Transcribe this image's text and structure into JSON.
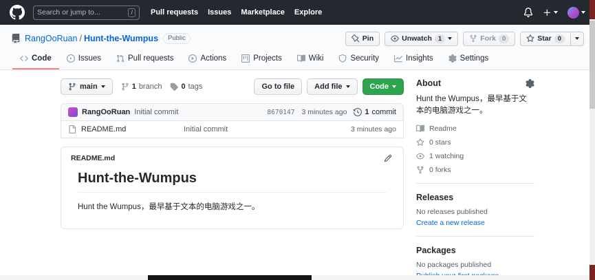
{
  "colors": {
    "header_bg": "#24292f",
    "link_blue": "#0366d6",
    "code_button_green": "#2ea44f",
    "active_tab_underline": "#f9826c",
    "commit_bar_bg": "#f6f8fa",
    "border": "#e1e4e8",
    "muted_text": "#586069",
    "scrollbar_red": "#7d2321"
  },
  "icons": {
    "github-logo": "github-octocat-mark",
    "bell": "notification-bell",
    "plus": "plus",
    "caret": "triangle-down",
    "repo": "repo-book",
    "pin": "pin",
    "eye": "eye",
    "fork": "git-fork",
    "star": "star-outline",
    "code": "angle-brackets",
    "issue": "circle-dot",
    "pull-request": "git-pull-request",
    "actions": "play-circle",
    "projects": "project-board",
    "wiki": "book",
    "security": "shield",
    "insights": "line-graph",
    "settings": "gear",
    "branch": "git-branch",
    "tag": "tag",
    "history": "clock-history",
    "file": "file-outline",
    "pencil": "pencil"
  },
  "header": {
    "search": {
      "placeholder": "Search or jump to...",
      "shortcut": "/"
    },
    "nav": [
      {
        "label": "Pull requests"
      },
      {
        "label": "Issues"
      },
      {
        "label": "Marketplace"
      },
      {
        "label": "Explore"
      }
    ]
  },
  "repo": {
    "owner": "RangOoRuan",
    "separator": "/",
    "name": "Hunt-the-Wumpus",
    "visibility": "Public",
    "actions": {
      "pin_label": "Pin",
      "unwatch_label": "Unwatch",
      "unwatch_count": "1",
      "fork_label": "Fork",
      "fork_count": "0",
      "star_label": "Star",
      "star_count": "0"
    }
  },
  "tabs": [
    {
      "label": "Code",
      "active": true
    },
    {
      "label": "Issues",
      "active": false
    },
    {
      "label": "Pull requests",
      "active": false
    },
    {
      "label": "Actions",
      "active": false
    },
    {
      "label": "Projects",
      "active": false
    },
    {
      "label": "Wiki",
      "active": false
    },
    {
      "label": "Security",
      "active": false
    },
    {
      "label": "Insights",
      "active": false
    },
    {
      "label": "Settings",
      "active": false
    }
  ],
  "toolbar": {
    "branch_button": "main",
    "branch_count": "1",
    "branch_word": "branch",
    "tag_count": "0",
    "tag_word": "tags",
    "go_to_file": "Go to file",
    "add_file": "Add file",
    "code": "Code"
  },
  "commit_bar": {
    "author": "RangOoRuan",
    "message": "Initial commit",
    "hash": "8670147",
    "time": "3 minutes ago",
    "commit_count_number": "1",
    "commit_count_word": "commit"
  },
  "files": [
    {
      "name": "README.md",
      "message": "Initial commit",
      "time": "3 minutes ago"
    }
  ],
  "readme": {
    "filename": "README.md",
    "heading": "Hunt-the-Wumpus",
    "body": "Hunt the Wumpus，最早基于文本的电脑游戏之一。"
  },
  "sidebar": {
    "about": {
      "title": "About",
      "description": "Hunt the Wumpus，最早基于文本的电脑游戏之一。",
      "stats": [
        {
          "icon": "book-icon",
          "label": "Readme"
        },
        {
          "icon": "star-icon",
          "label": "0 stars"
        },
        {
          "icon": "eye-icon",
          "label": "1 watching"
        },
        {
          "icon": "fork-icon",
          "label": "0 forks"
        }
      ]
    },
    "releases": {
      "title": "Releases",
      "empty": "No releases published",
      "link": "Create a new release"
    },
    "packages": {
      "title": "Packages",
      "empty": "No packages published",
      "link": "Publish your first package"
    }
  }
}
